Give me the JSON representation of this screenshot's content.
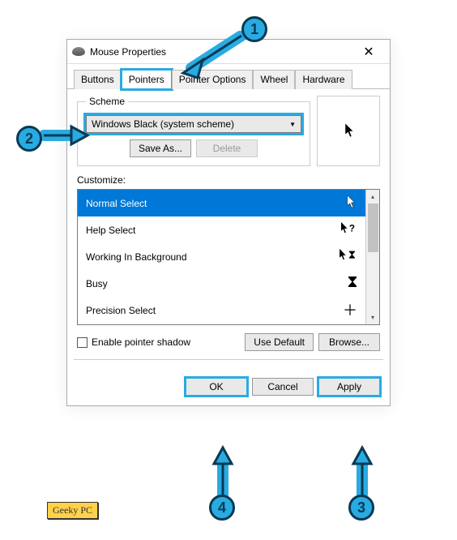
{
  "window": {
    "title": "Mouse Properties"
  },
  "tabs": {
    "t0": "Buttons",
    "t1": "Pointers",
    "t2": "Pointer Options",
    "t3": "Wheel",
    "t4": "Hardware"
  },
  "scheme": {
    "legend": "Scheme",
    "selected": "Windows Black (system scheme)",
    "save_as": "Save As...",
    "delete": "Delete"
  },
  "customize": {
    "label": "Customize:",
    "items": [
      {
        "label": "Normal Select",
        "icon": "cursor"
      },
      {
        "label": "Help Select",
        "icon": "help-cursor"
      },
      {
        "label": "Working In Background",
        "icon": "cursor-hourglass"
      },
      {
        "label": "Busy",
        "icon": "hourglass"
      },
      {
        "label": "Precision Select",
        "icon": "crosshair"
      }
    ]
  },
  "options": {
    "enable_shadow": "Enable pointer shadow",
    "use_default": "Use Default",
    "browse": "Browse..."
  },
  "footer": {
    "ok": "OK",
    "cancel": "Cancel",
    "apply": "Apply"
  },
  "annotations": {
    "c1": "1",
    "c2": "2",
    "c3": "3",
    "c4": "4"
  },
  "watermark": "Geeky PC"
}
